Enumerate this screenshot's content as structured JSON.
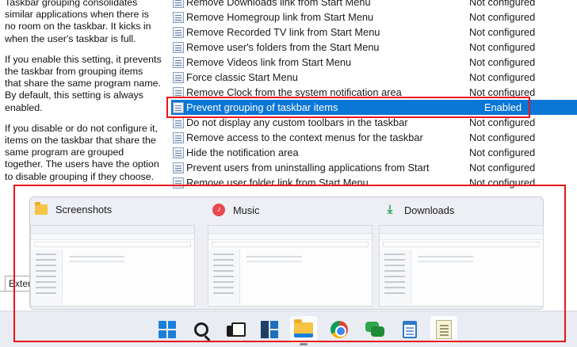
{
  "description": {
    "paragraphs": [
      "Taskbar grouping consolidates similar applications when there is no room on the taskbar. It kicks in when the user's taskbar is full.",
      "If you enable this setting, it prevents the taskbar from grouping items that share the same program name. By default, this setting is always enabled.",
      "If you disable or do not configure it, items on the taskbar that share the same program are grouped together. The users have the option to disable grouping if they choose."
    ]
  },
  "policies": [
    {
      "name": "Remove Downloads link from Start Menu",
      "state": "Not configured"
    },
    {
      "name": "Remove Homegroup link from Start Menu",
      "state": "Not configured"
    },
    {
      "name": "Remove Recorded TV link from Start Menu",
      "state": "Not configured"
    },
    {
      "name": "Remove user's folders from the Start Menu",
      "state": "Not configured"
    },
    {
      "name": "Remove Videos link from Start Menu",
      "state": "Not configured"
    },
    {
      "name": "Force classic Start Menu",
      "state": "Not configured"
    },
    {
      "name": "Remove Clock from the system notification area",
      "state": "Not configured"
    },
    {
      "name": "Prevent grouping of taskbar items",
      "state": "Enabled",
      "selected": true
    },
    {
      "name": "Do not display any custom toolbars in the taskbar",
      "state": "Not configured"
    },
    {
      "name": "Remove access to the context menus for the taskbar",
      "state": "Not configured"
    },
    {
      "name": "Hide the notification area",
      "state": "Not configured"
    },
    {
      "name": "Prevent users from uninstalling applications from Start",
      "state": "Not configured"
    },
    {
      "name": "Remove user folder link from Start Menu",
      "state": "Not configured"
    }
  ],
  "tab_fragment": "Exten",
  "thumbnails": [
    {
      "title": "Screenshots",
      "icon": "folder-icon"
    },
    {
      "title": "Music",
      "icon": "music-icon"
    },
    {
      "title": "Downloads",
      "icon": "download-icon"
    }
  ],
  "taskbar": {
    "icons": [
      "windows-start-icon",
      "search-icon",
      "task-view-icon",
      "widgets-icon",
      "file-explorer-icon",
      "chrome-icon",
      "chat-icon",
      "notepad-icon",
      "wordpad-icon"
    ]
  },
  "colors": {
    "selection": "#0a76d6",
    "highlight": "#e8141a",
    "folder": "#f6c344"
  }
}
